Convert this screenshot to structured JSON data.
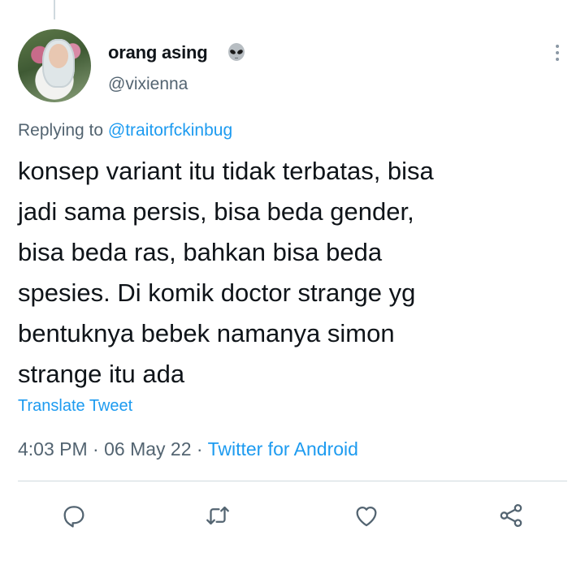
{
  "tweet": {
    "author": {
      "display_name": "orang asing",
      "handle": "@vixienna",
      "name_emoji": "alien-icon"
    },
    "reply": {
      "prefix": "Replying to",
      "mention": "@traitorfckinbug"
    },
    "text": "konsep variant itu tidak terbatas, bisa\njadi sama persis, bisa beda gender,\nbisa beda ras, bahkan bisa beda\nspesies. Di komik doctor strange yg\nbentuknya bebek namanya simon\nstrange itu ada",
    "translate_label": "Translate Tweet",
    "time": "4:03 PM",
    "date": "06 May 22",
    "separator": "·",
    "source": "Twitter for Android"
  },
  "actions": [
    {
      "name": "reply",
      "icon": "reply-icon"
    },
    {
      "name": "retweet",
      "icon": "retweet-icon"
    },
    {
      "name": "like",
      "icon": "heart-icon"
    },
    {
      "name": "share",
      "icon": "share-icon"
    }
  ],
  "colors": {
    "link": "#1d9bf0",
    "secondary_text": "#536471",
    "primary_text": "#0f1419",
    "icon": "#536471"
  }
}
